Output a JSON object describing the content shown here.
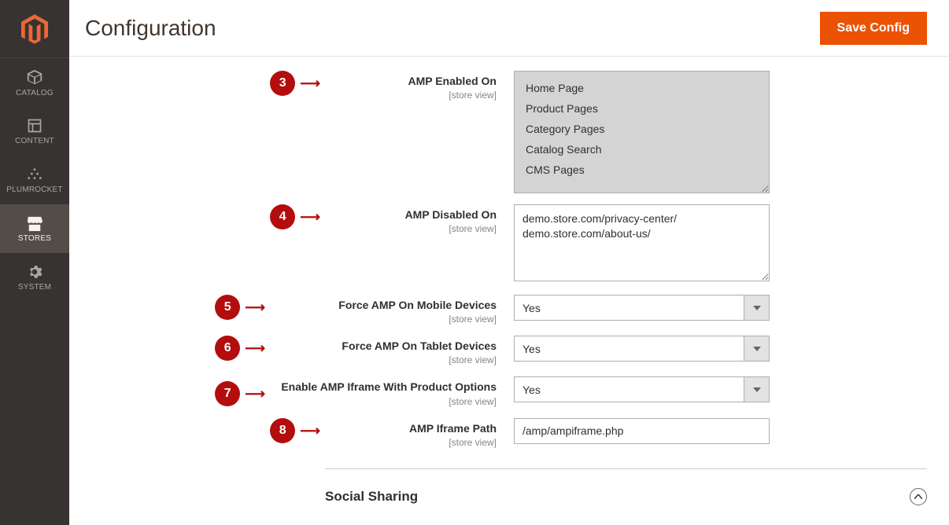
{
  "sidebar": {
    "items": [
      {
        "label": "CATALOG"
      },
      {
        "label": "CONTENT"
      },
      {
        "label": "PLUMROCKET"
      },
      {
        "label": "STORES"
      },
      {
        "label": "SYSTEM"
      }
    ]
  },
  "header": {
    "title": "Configuration",
    "save_button": "Save Config"
  },
  "badges": {
    "n3": "3",
    "n4": "4",
    "n5": "5",
    "n6": "6",
    "n7": "7",
    "n8": "8"
  },
  "fields": {
    "amp_enabled": {
      "label": "AMP Enabled On",
      "scope": "[store view]",
      "options": [
        "Home Page",
        "Product Pages",
        "Category Pages",
        "Catalog Search",
        "CMS Pages"
      ]
    },
    "amp_disabled": {
      "label": "AMP Disabled On",
      "scope": "[store view]",
      "value": "demo.store.com/privacy-center/\ndemo.store.com/about-us/"
    },
    "force_mobile": {
      "label": "Force AMP On Mobile Devices",
      "scope": "[store view]",
      "value": "Yes"
    },
    "force_tablet": {
      "label": "Force AMP On Tablet Devices",
      "scope": "[store view]",
      "value": "Yes"
    },
    "enable_iframe": {
      "label": "Enable AMP Iframe With Product Options",
      "scope": "[store view]",
      "value": "Yes"
    },
    "iframe_path": {
      "label": "AMP Iframe Path",
      "scope": "[store view]",
      "value": "/amp/ampiframe.php"
    }
  },
  "section": {
    "social_sharing_title": "Social Sharing"
  }
}
